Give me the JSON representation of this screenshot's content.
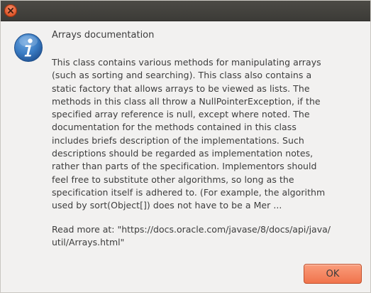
{
  "dialog": {
    "title": "Arrays documentation",
    "message_lines": [
      "This class contains various methods for manipulating arrays",
      "(such as sorting and searching). This class also contains a",
      "static factory that allows arrays to be viewed as lists. The",
      "methods in this class all throw a NullPointerException, if the",
      "specified array reference is null, except where noted. The",
      "documentation for the methods contained in this class",
      "includes briefs description of the implementations. Such",
      "descriptions should be regarded as implementation notes,",
      "rather than parts of the specification. Implementors should",
      "feel free to substitute other algorithms, so long as the",
      "specification itself is adhered to. (For example, the algorithm",
      "used by sort(Object[]) does not have to be a Mer ..."
    ],
    "read_more_lines": [
      "Read more at: \"https://docs.oracle.com/javase/8/docs/api/java/",
      "util/Arrays.html\""
    ],
    "ok_label": "OK"
  },
  "colors": {
    "titlebar": "#3c3b37",
    "close_button": "#e25a2d",
    "ok_button": "#f0744c",
    "info_icon": "#2f6fb5",
    "background": "#f2f1f0"
  },
  "icons": {
    "close": "close-icon",
    "info": "info-icon"
  }
}
